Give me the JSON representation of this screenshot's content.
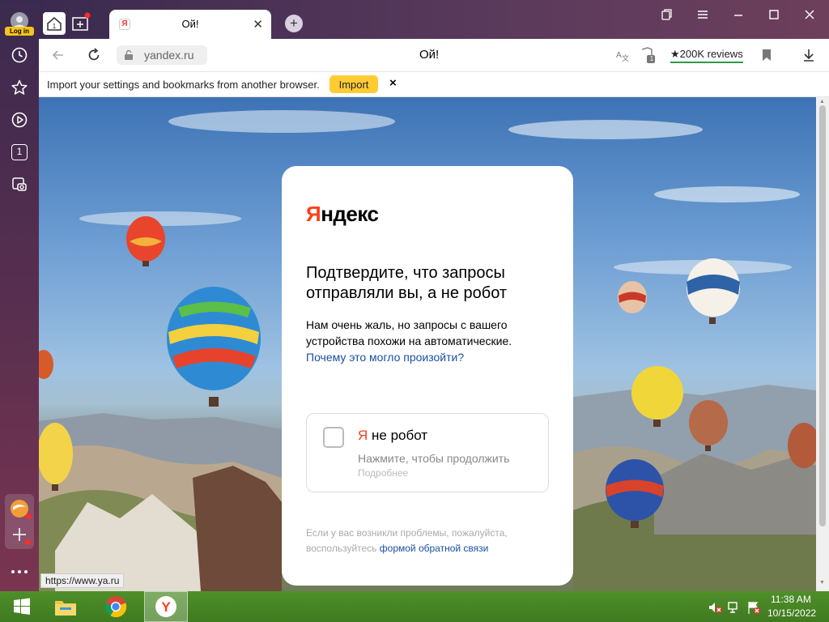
{
  "sidebar": {
    "login_label": "Log in",
    "tab_counter": "1"
  },
  "titlebar": {
    "tab_title": "Ой!",
    "tab_favicon": "Я"
  },
  "addressbar": {
    "url": "yandex.ru",
    "page_title": "Ой!",
    "reviews": "★200K reviews",
    "tab_badge": "1"
  },
  "infobar": {
    "text": "Import your settings and bookmarks from another browser.",
    "import_label": "Import",
    "close_label": "×"
  },
  "captcha": {
    "logo_ya": "Я",
    "logo_rest": "ндекс",
    "heading": "Подтвердите, что запросы отправляли вы, а не робот",
    "desc_text": "Нам очень жаль, но запросы с вашего устройства похожи на автоматические. ",
    "desc_link": "Почему это могло произойти?",
    "robot_ya": "Я",
    "robot_rest": " не робот",
    "robot_sub": "Нажмите, чтобы продолжить",
    "robot_more": "Подробнее",
    "footer_text": "Если у вас возникли проблемы, пожалуйста, воспользуйтесь ",
    "footer_link": "формой обратной связи"
  },
  "status_tip": "https://www.ya.ru",
  "taskbar": {
    "time": "11:38 AM",
    "date": "10/15/2022"
  },
  "colors": {
    "yandex_red": "#fc3f1d",
    "import_yellow": "#ffcc33",
    "taskbar_green": "#4f8f2a"
  }
}
